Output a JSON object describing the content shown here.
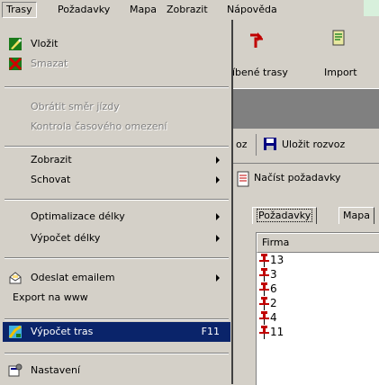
{
  "menubar": {
    "items": [
      {
        "label": "Trasy"
      },
      {
        "label": "Požadavky"
      },
      {
        "label": "Mapa"
      },
      {
        "label": "Zobrazit"
      },
      {
        "label": "Nápověda"
      }
    ]
  },
  "toolbar": {
    "favorites_label": "íbené trasy",
    "import_label": "Import"
  },
  "row2": {
    "save_prefix": "oz",
    "save_label": "Uložit rozvoz"
  },
  "row3": {
    "load_label": "Načíst požadavky"
  },
  "tabs": [
    {
      "label": "Požadavky"
    },
    {
      "label": "Mapa"
    }
  ],
  "list": {
    "header": "Firma",
    "rows": [
      "13",
      "3",
      "6",
      "2",
      "4",
      "11"
    ]
  },
  "menu": {
    "items": [
      {
        "label": "Vložit",
        "icon": "insert-icon"
      },
      {
        "label": "Smazat",
        "icon": "delete-icon"
      },
      {
        "label": "Obrátit směr jízdy"
      },
      {
        "label": "Kontrola časového omezení"
      },
      {
        "label": "Zobrazit"
      },
      {
        "label": "Schovat"
      },
      {
        "label": "Optimalizace délky"
      },
      {
        "label": "Výpočet délky"
      },
      {
        "label": "Odeslat emailem",
        "icon": "email-icon"
      },
      {
        "label": "Export na www"
      },
      {
        "label": "Výpočet tras",
        "shortcut": "F11",
        "icon": "route-calc-icon"
      },
      {
        "label": "Nastavení",
        "icon": "settings-icon"
      }
    ]
  },
  "colors": {
    "highlight": "#0a246a",
    "face": "#d4d0c8"
  }
}
